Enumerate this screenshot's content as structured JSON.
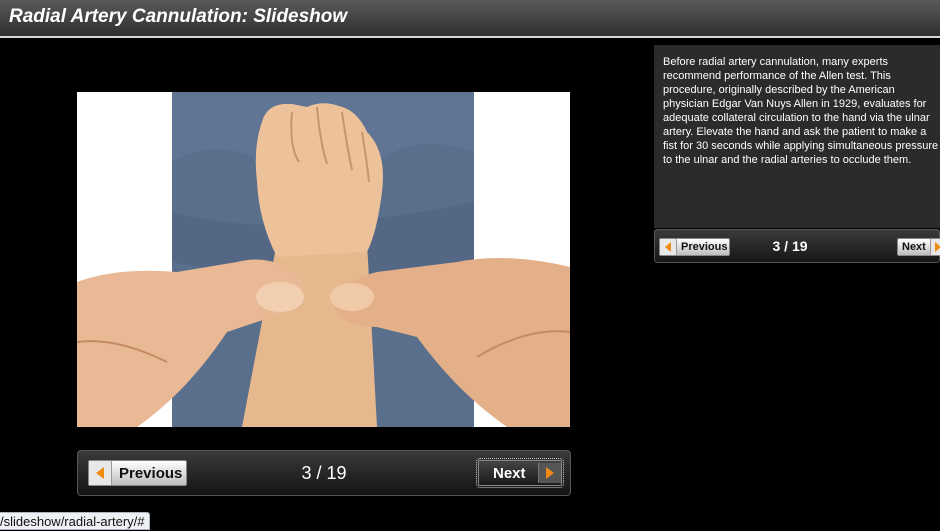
{
  "title": "Radial Artery Cannulation: Slideshow",
  "caption": "Before radial artery cannulation, many experts recommend performance of the Allen test. This procedure, originally described by the American physician Edgar Van Nuys Allen in 1929, evaluates for adequate collateral circulation to the hand via the ulnar artery. Elevate the hand and ask the patient to make a fist for 30 seconds while applying simultaneous pressure to the ulnar and the radial arteries to occlude them.",
  "navigation": {
    "previous_label": "Previous",
    "next_label": "Next",
    "counter": "3 / 19"
  },
  "status_bar": {
    "url": "/slideshow/radial-artery/#"
  },
  "colors": {
    "arrow_accent": "#f08a12",
    "background": "#000000",
    "caption_panel": "#2b2b2b"
  },
  "icons": {
    "previous": "left-arrow-icon",
    "next": "right-arrow-icon"
  }
}
